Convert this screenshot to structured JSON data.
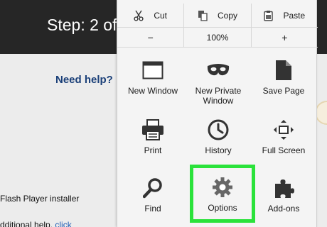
{
  "background": {
    "step_text": "Step: 2 of",
    "help_link": "Need help?",
    "line1": "Flash Player installer",
    "line2_text": "dditional help, ",
    "line2_link": "click"
  },
  "menu": {
    "edit": [
      {
        "label": "Cut",
        "icon": "scissors-icon"
      },
      {
        "label": "Copy",
        "icon": "copy-icon"
      },
      {
        "label": "Paste",
        "icon": "clipboard-icon"
      }
    ],
    "zoom": {
      "out": "−",
      "level": "100%",
      "in": "+"
    },
    "items": [
      {
        "label": "New Window",
        "icon": "new-window-icon"
      },
      {
        "label": "New Private Window",
        "icon": "mask-icon"
      },
      {
        "label": "Save Page",
        "icon": "save-page-icon"
      },
      {
        "label": "Print",
        "icon": "printer-icon"
      },
      {
        "label": "History",
        "icon": "clock-icon"
      },
      {
        "label": "Full Screen",
        "icon": "fullscreen-icon"
      },
      {
        "label": "Find",
        "icon": "magnifier-icon"
      },
      {
        "label": "Options",
        "icon": "gear-icon",
        "highlighted": true
      },
      {
        "label": "Add-ons",
        "icon": "puzzle-icon"
      }
    ],
    "highlight_color": "#2ae23a"
  }
}
